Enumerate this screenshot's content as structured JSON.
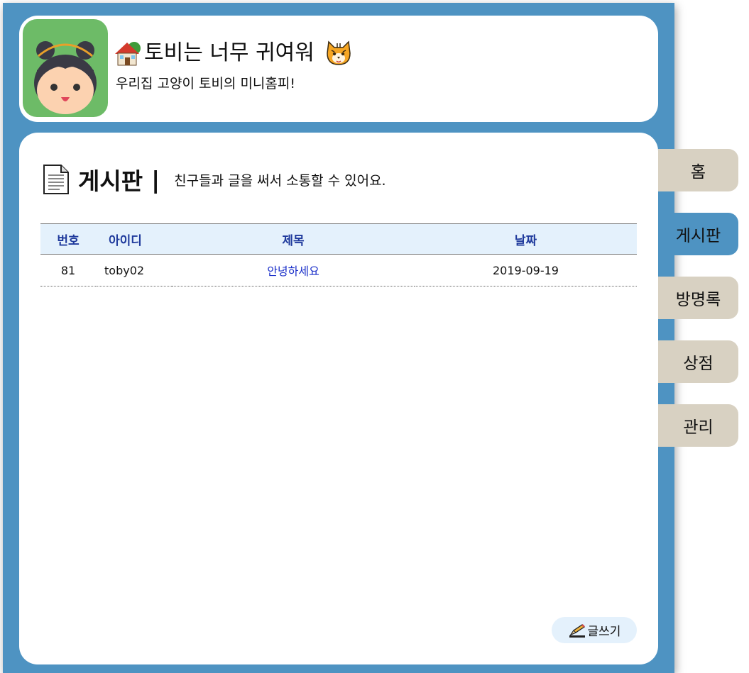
{
  "site": {
    "title": "토비는 너무 귀여워",
    "subtitle": "우리집 고양이 토비의 미니홈피!",
    "house_icon": "house-icon",
    "cat_icon": "cat-face-icon"
  },
  "board": {
    "title": "게시판",
    "separator": "|",
    "description": "친구들과 글을 써서 소통할 수 있어요.",
    "columns": [
      "번호",
      "아이디",
      "제목",
      "날짜"
    ],
    "rows": [
      {
        "no": "81",
        "id": "toby02",
        "title": "안녕하세요",
        "date": "2019-09-19"
      }
    ],
    "write_label": "글쓰기"
  },
  "nav": {
    "tabs": [
      {
        "label": "홈",
        "active": false
      },
      {
        "label": "게시판",
        "active": true
      },
      {
        "label": "방명록",
        "active": false
      },
      {
        "label": "상점",
        "active": false
      },
      {
        "label": "관리",
        "active": false
      }
    ]
  },
  "colors": {
    "frame": "#4e93c2",
    "tab_inactive": "#d8d1c2",
    "table_header_bg": "#e4f1fc",
    "table_header_text": "#1f3a9c",
    "link": "#1a2fc9",
    "avatar_bg": "#6dbb67"
  }
}
